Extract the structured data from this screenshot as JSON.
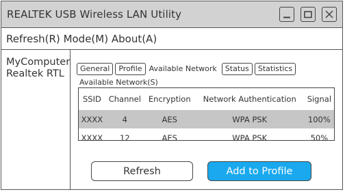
{
  "window": {
    "title": "REALTEK USB Wireless LAN Utility"
  },
  "menu": {
    "items": [
      "Refresh(R)",
      "Mode(M)",
      "About(A)"
    ]
  },
  "sidebar": {
    "line1": "MyComputer",
    "line2": "Realtek RTL"
  },
  "tabs": [
    {
      "label": "General",
      "boxed": true
    },
    {
      "label": "Profile",
      "boxed": true
    },
    {
      "label": "Available Network",
      "boxed": false,
      "active": true
    },
    {
      "label": "Status",
      "boxed": true
    },
    {
      "label": "Statistics",
      "boxed": true
    }
  ],
  "networks": {
    "section_label": "Available Network(S)",
    "columns": [
      "SSID",
      "Channel",
      "Encryption",
      "Network Authentication",
      "Signal"
    ],
    "rows": [
      {
        "ssid": "XXXX",
        "channel": "4",
        "encryption": "AES",
        "auth": "WPA PSK",
        "signal": "100%",
        "selected": true
      },
      {
        "ssid": "XXXX",
        "channel": "12",
        "encryption": "AES",
        "auth": "WPA PSK",
        "signal": "50%",
        "selected": false
      }
    ]
  },
  "buttons": {
    "refresh": "Refresh",
    "add_to_profile": "Add to Profile"
  },
  "colors": {
    "titlebar": "#d2d2d2",
    "accent": "#1aa9ee",
    "selected_row": "#c6c6c6"
  },
  "icons": [
    "minimize-icon",
    "maximize-icon",
    "close-icon"
  ]
}
